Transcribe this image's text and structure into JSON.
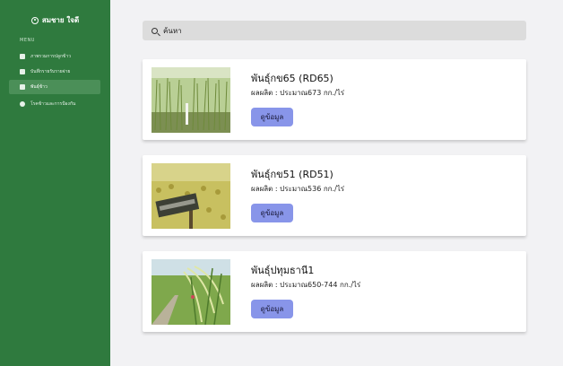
{
  "sidebar": {
    "brand": "สมชาย ใจดี",
    "menu_heading": "MENU",
    "items": [
      {
        "label": "ภาพรวมการปลูกข้าว",
        "icon": "dashboard-icon"
      },
      {
        "label": "บันทึกรายรับรายจ่าย",
        "icon": "clipboard-icon"
      },
      {
        "label": "พันธุ์ข้าว",
        "icon": "book-icon",
        "active": true
      },
      {
        "label": "โรคข้าวและการป้องกัน",
        "icon": "chat-icon"
      }
    ]
  },
  "search": {
    "placeholder": "ค้นหา"
  },
  "varieties": [
    {
      "name": "พันธุ์กข65 (RD65)",
      "yield": "ผลผลิต : ประมาณ673 กก./ไร่",
      "button": "ดูข้อมูล"
    },
    {
      "name": "พันธุ์กข51 (RD51)",
      "yield": "ผลผลิต : ประมาณ536 กก./ไร่",
      "button": "ดูข้อมูล"
    },
    {
      "name": "พันธุ์ปทุมธานี1",
      "yield": "ผลผลิต : ประมาณ650-744 กก./ไร่",
      "button": "ดูข้อมูล"
    }
  ],
  "colors": {
    "sidebar": "#2f7a3e",
    "button": "#8895e9",
    "background": "#f2f2f4"
  }
}
